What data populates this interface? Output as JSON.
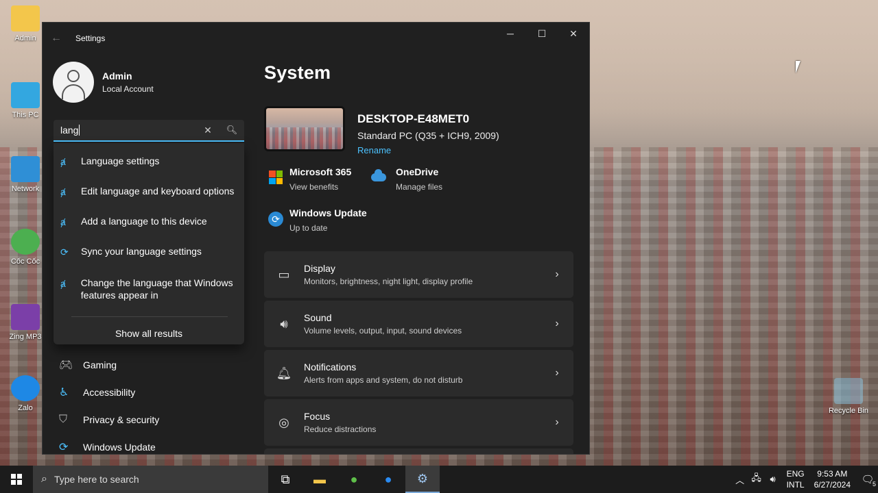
{
  "desktop": {
    "icons": [
      {
        "label": "Admin"
      },
      {
        "label": "This PC"
      },
      {
        "label": "Network"
      },
      {
        "label": "Cốc Cốc"
      },
      {
        "label": "Zing MP3"
      },
      {
        "label": "Zalo"
      },
      {
        "label": "Recycle Bin"
      }
    ]
  },
  "window": {
    "title": "Settings",
    "back_glyph": "←",
    "minimize": "─",
    "maximize": "☐",
    "close": "✕"
  },
  "profile": {
    "name": "Admin",
    "account_type": "Local Account"
  },
  "search": {
    "value": "lang",
    "results": [
      {
        "label": "Language settings"
      },
      {
        "label": "Edit language and keyboard options"
      },
      {
        "label": "Add a language to this device"
      },
      {
        "label": "Sync your language settings"
      },
      {
        "label": "Change the language that Windows features appear in"
      }
    ],
    "show_all": "Show all results"
  },
  "nav": {
    "items": [
      {
        "label": "Gaming",
        "icon": "gamepad-icon"
      },
      {
        "label": "Accessibility",
        "icon": "accessibility-icon"
      },
      {
        "label": "Privacy & security",
        "icon": "shield-icon"
      },
      {
        "label": "Windows Update",
        "icon": "update-icon"
      }
    ]
  },
  "main": {
    "page_title": "System",
    "device": {
      "name": "DESKTOP-E48MET0",
      "model": "Standard PC (Q35 + ICH9, 2009)",
      "rename": "Rename"
    },
    "quick_links": [
      {
        "title": "Microsoft 365",
        "sub": "View benefits"
      },
      {
        "title": "OneDrive",
        "sub": "Manage files"
      },
      {
        "title": "Windows Update",
        "sub": "Up to date"
      }
    ],
    "cards": [
      {
        "title": "Display",
        "sub": "Monitors, brightness, night light, display profile"
      },
      {
        "title": "Sound",
        "sub": "Volume levels, output, input, sound devices"
      },
      {
        "title": "Notifications",
        "sub": "Alerts from apps and system, do not disturb"
      },
      {
        "title": "Focus",
        "sub": "Reduce distractions"
      }
    ]
  },
  "taskbar": {
    "search_placeholder": "Type here to search",
    "lang_top": "ENG",
    "lang_bottom": "INTL",
    "time": "9:53 AM",
    "date": "6/27/2024",
    "notification_count": "5"
  },
  "colors": {
    "accent": "#4cc2ff",
    "window_bg": "#202020",
    "card_bg": "#2b2b2b"
  }
}
